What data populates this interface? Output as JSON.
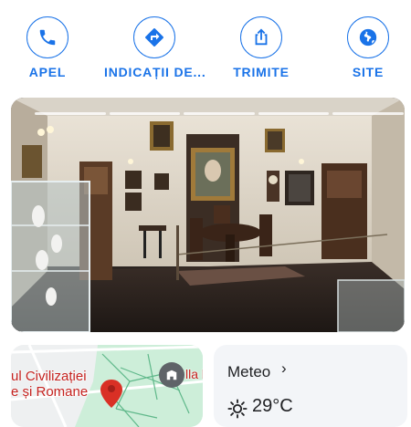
{
  "actions": [
    {
      "label": "APEL",
      "icon": "phone-icon"
    },
    {
      "label": "INDICAȚII DE...",
      "icon": "directions-icon"
    },
    {
      "label": "TRIMITE",
      "icon": "share-icon"
    },
    {
      "label": "SITE",
      "icon": "globe-icon"
    }
  ],
  "accent_color": "#1a73e8",
  "map": {
    "label_line1": "ul Civilizației",
    "label_line2": "e și Romane",
    "nearby_label": "lla l"
  },
  "weather": {
    "title": "Meteo",
    "chevron": "›",
    "temperature": "29°C",
    "icon": "sun-icon"
  }
}
